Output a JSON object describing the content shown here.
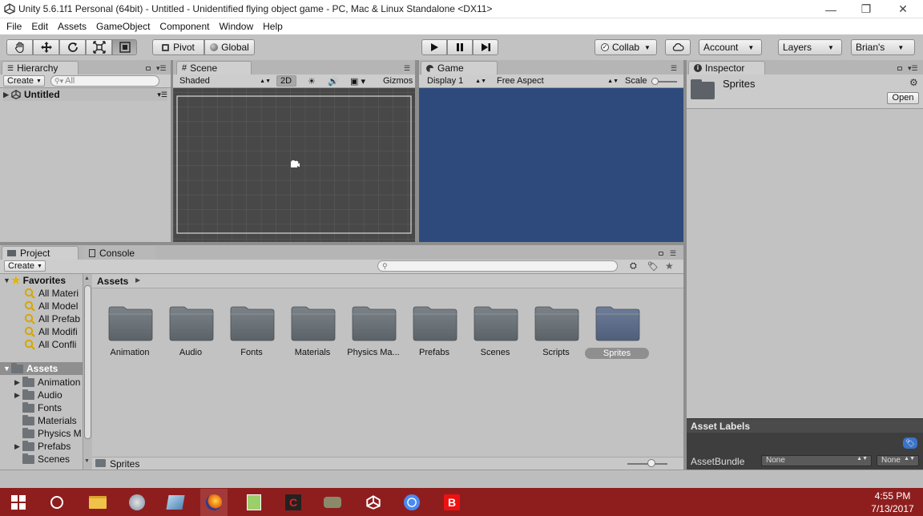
{
  "window": {
    "title": "Unity 5.6.1f1 Personal (64bit) - Untitled - Unidentified flying object game - PC, Mac & Linux Standalone <DX11>",
    "minimize": "—",
    "maximize": "❐",
    "close": "✕"
  },
  "menu": [
    "File",
    "Edit",
    "Assets",
    "GameObject",
    "Component",
    "Window",
    "Help"
  ],
  "toolbar": {
    "pivot": "Pivot",
    "global": "Global",
    "collab": "Collab",
    "account": "Account",
    "layers": "Layers",
    "layout": "Brian's"
  },
  "hierarchy": {
    "tab": "Hierarchy",
    "create": "Create",
    "search_value": "All",
    "scene_name": "Untitled"
  },
  "scene": {
    "tab": "Scene",
    "shading": "Shaded",
    "mode_2d": "2D",
    "gizmos": "Gizmos"
  },
  "game": {
    "tab": "Game",
    "display": "Display 1",
    "aspect": "Free Aspect",
    "scale": "Scale",
    "bg_color": "#2e4a7c"
  },
  "inspector": {
    "tab": "Inspector",
    "object_name": "Sprites",
    "open_button": "Open",
    "asset_labels": "Asset Labels",
    "asset_bundle": "AssetBundle",
    "bundle_value": "None",
    "variant_value": "None"
  },
  "project": {
    "tab": "Project",
    "console_tab": "Console",
    "create": "Create",
    "favorites_label": "Favorites",
    "favorites": [
      "All Materi",
      "All Model",
      "All Prefab",
      "All Modifi",
      "All Confli"
    ],
    "assets_label": "Assets",
    "tree_assets": [
      {
        "name": "Animation",
        "expandable": true
      },
      {
        "name": "Audio",
        "expandable": true
      },
      {
        "name": "Fonts",
        "expandable": false
      },
      {
        "name": "Materials",
        "expandable": false
      },
      {
        "name": "Physics M",
        "expandable": false
      },
      {
        "name": "Prefabs",
        "expandable": true
      },
      {
        "name": "Scenes",
        "expandable": false
      }
    ],
    "breadcrumb": "Assets",
    "folders": [
      "Animation",
      "Audio",
      "Fonts",
      "Materials",
      "Physics Ma...",
      "Prefabs",
      "Scenes",
      "Scripts",
      "Sprites"
    ],
    "selected_folder": "Sprites",
    "footer_path": "Sprites"
  },
  "taskbar": {
    "time": "4:55 PM",
    "date": "7/13/2017"
  },
  "colors": {
    "accent_taskbar": "#8e1e1e",
    "panel": "#c2c2c2",
    "scene_bg": "#484848"
  }
}
